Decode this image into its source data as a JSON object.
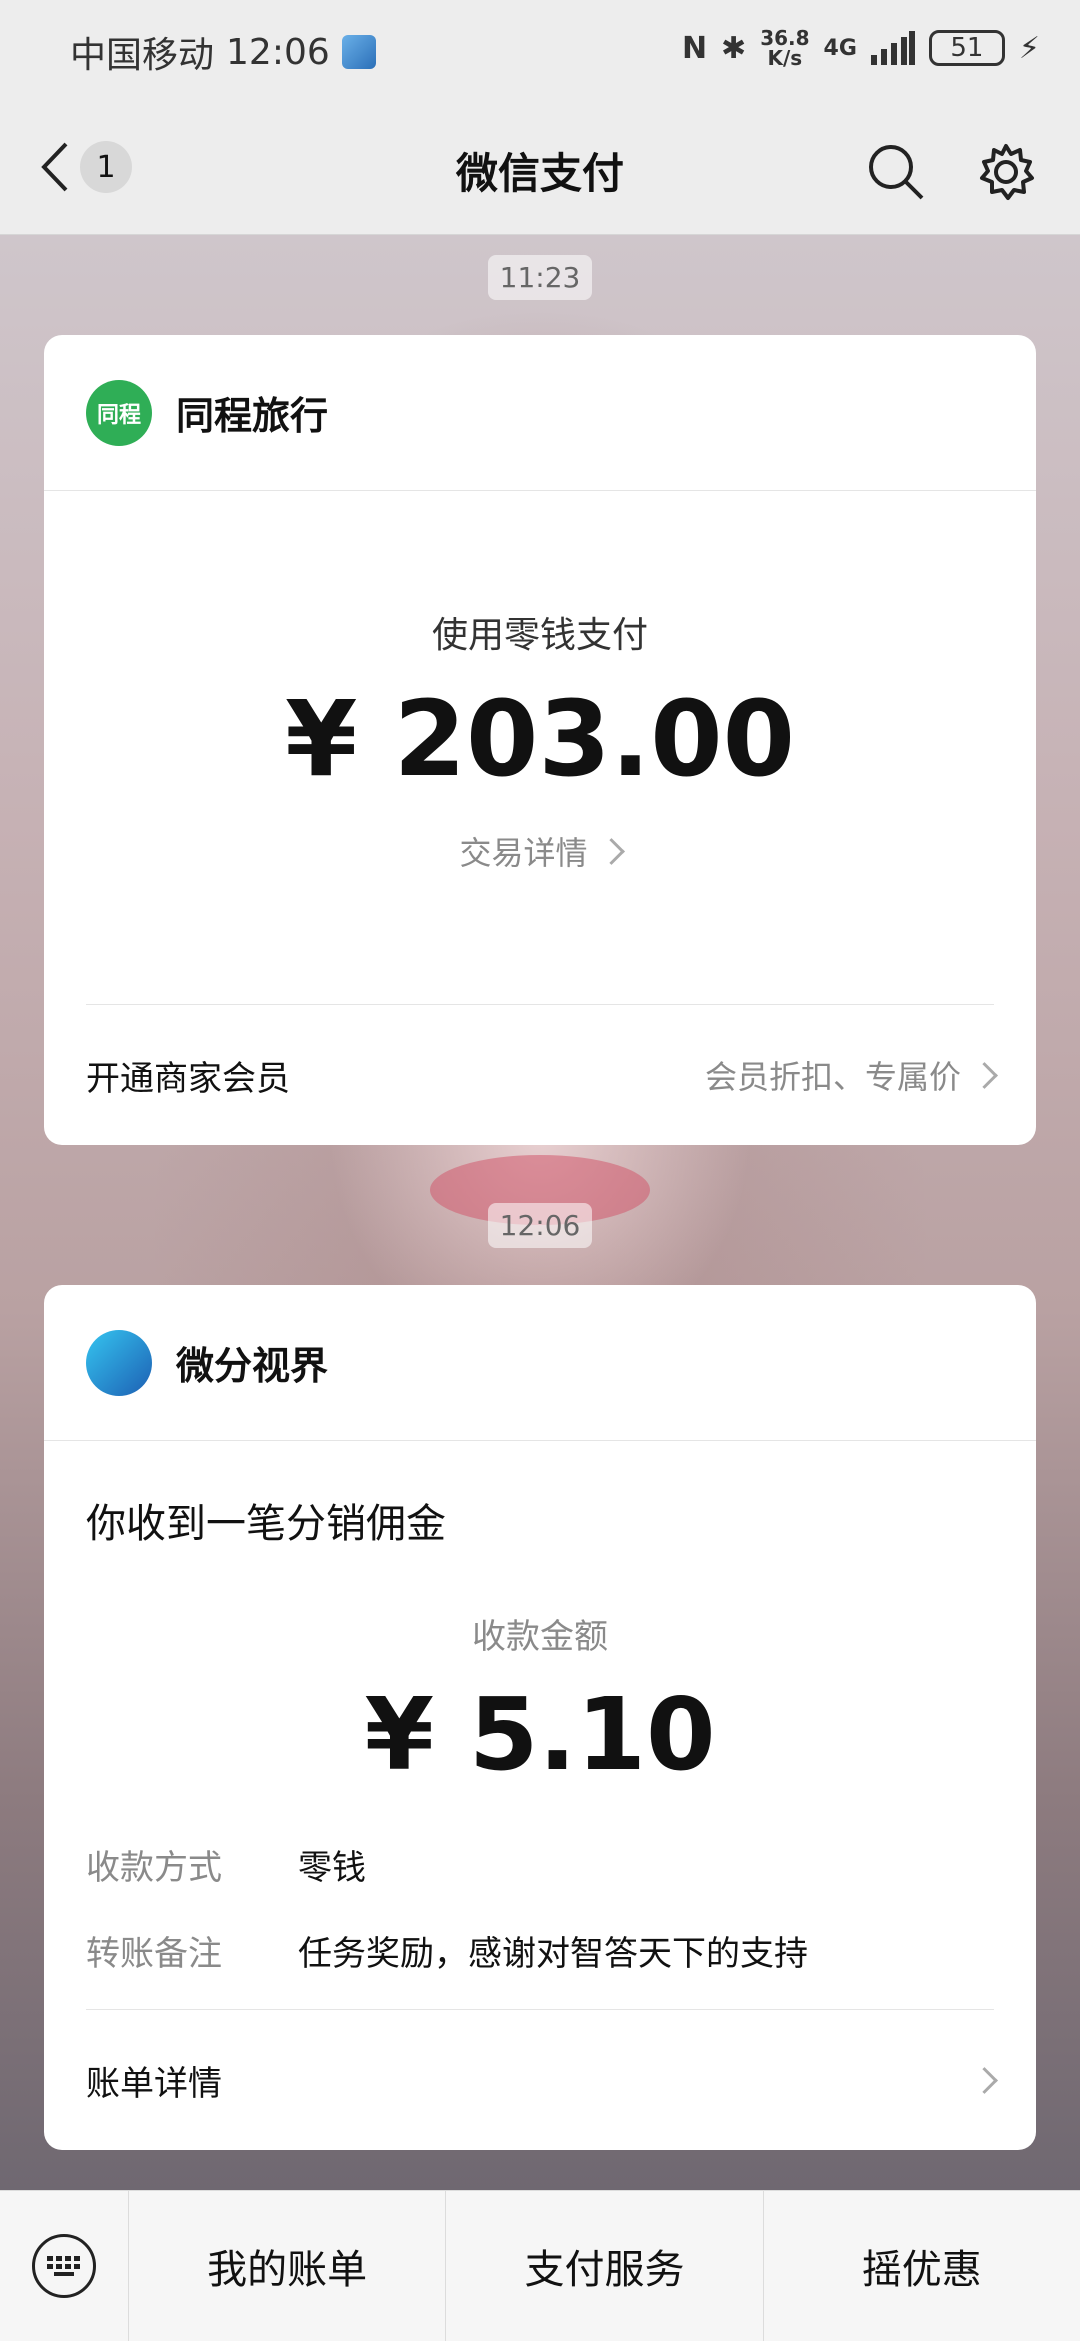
{
  "status_bar": {
    "carrier": "中国移动",
    "time": "12:06",
    "net_speed_value": "36.8",
    "net_speed_unit": "K/s",
    "network": "4G",
    "battery": "51"
  },
  "nav": {
    "back_count": "1",
    "title": "微信支付"
  },
  "messages": [
    {
      "timestamp": "11:23",
      "merchant": "同程旅行",
      "logo_text": "同程",
      "pay_method": "使用零钱支付",
      "amount": "¥ 203.00",
      "detail_link": "交易详情",
      "footer_label": "开通商家会员",
      "footer_hint": "会员折扣、专属价"
    },
    {
      "timestamp": "12:06",
      "merchant": "微分视界",
      "title": "你收到一笔分销佣金",
      "amount_label": "收款金额",
      "amount": "¥ 5.10",
      "method_label": "收款方式",
      "method_value": "零钱",
      "note_label": "转账备注",
      "note_value": "任务奖励，感谢对智答天下的支持",
      "footer_label": "账单详情"
    }
  ],
  "bottom_menu": [
    "我的账单",
    "支付服务",
    "摇优惠"
  ],
  "colors": {
    "background": "#ededed",
    "card": "#ffffff",
    "muted_text": "#8a8a8a"
  }
}
